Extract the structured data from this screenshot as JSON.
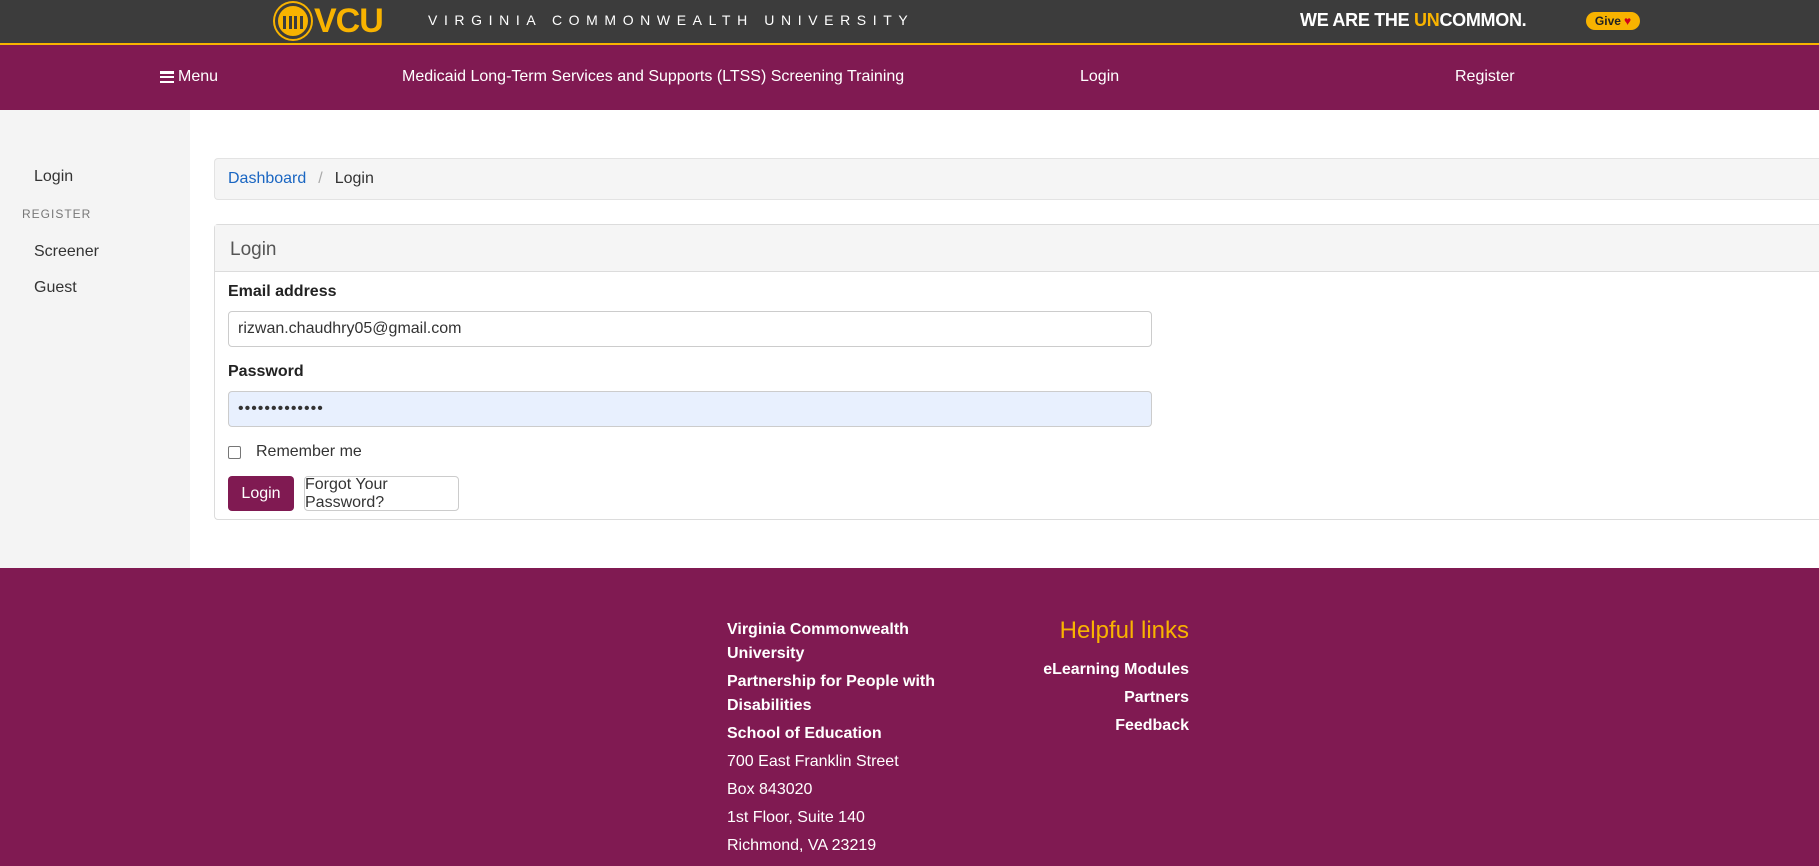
{
  "brand_bar": {
    "logo_text": "VCU",
    "university_name": "VIRGINIA COMMONWEALTH UNIVERSITY",
    "tagline_prefix": "WE ARE THE ",
    "tagline_highlight": "UN",
    "tagline_suffix": "COMMON.",
    "give_label": "Give"
  },
  "navbar": {
    "menu_label": "Menu",
    "site_title": "Medicaid Long-Term Services and Supports (LTSS) Screening Training",
    "login_label": "Login",
    "register_label": "Register"
  },
  "sidebar": {
    "login_label": "Login",
    "register_header": "REGISTER",
    "items": [
      {
        "label": "Screener"
      },
      {
        "label": "Guest"
      }
    ]
  },
  "breadcrumb": {
    "items": [
      {
        "label": "Dashboard"
      },
      {
        "label": "Login"
      }
    ],
    "separator": "/"
  },
  "login_panel": {
    "title": "Login",
    "email_label": "Email address",
    "email_value": "rizwan.chaudhry05@gmail.com",
    "password_label": "Password",
    "password_value": "•••••••••••••",
    "remember_label": "Remember me",
    "login_button": "Login",
    "forgot_button": "Forgot Your Password?"
  },
  "footer": {
    "org_lines": [
      "Virginia Commonwealth University",
      "Partnership for People with Disabilities",
      "School of Education"
    ],
    "address_lines": [
      "700 East Franklin Street",
      "Box 843020",
      "1st Floor, Suite 140",
      "Richmond, VA 23219"
    ],
    "helpful_links_title": "Helpful links",
    "links": [
      {
        "label": "eLearning Modules"
      },
      {
        "label": "Partners"
      },
      {
        "label": "Feedback"
      }
    ]
  },
  "colors": {
    "maroon": "#801a52",
    "gold": "#f8b300",
    "top_bar": "#3c3c3c",
    "link_blue": "#1a66c2"
  }
}
